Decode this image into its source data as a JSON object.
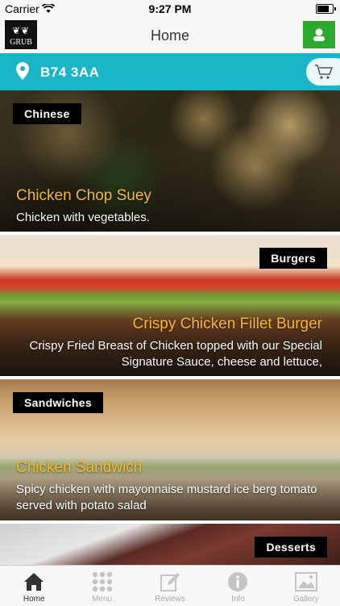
{
  "status_bar": {
    "carrier": "Carrier",
    "time": "9:27 PM"
  },
  "nav": {
    "logo_text": "GRUB",
    "title": "Home"
  },
  "location": {
    "postcode": "B74 3AA"
  },
  "colors": {
    "accent": "#1ab6c8",
    "dish_name": "#f5b830",
    "profile": "#2fa82f"
  },
  "cards": [
    {
      "category": "Chinese",
      "name": "Chicken Chop Suey",
      "description": "Chicken with vegetables."
    },
    {
      "category": "Burgers",
      "name": "Crispy Chicken Fillet Burger",
      "description": "Crispy Fried Breast of Chicken topped with our Special Signature Sauce, cheese and lettuce,"
    },
    {
      "category": "Sandwiches",
      "name": "Chicken Sandwich",
      "description": "Spicy chicken with mayonnaise mustard ice berg tomato served with potato salad"
    },
    {
      "category": "Desserts"
    }
  ],
  "tabs": [
    {
      "label": "Home",
      "icon": "home-icon",
      "active": true
    },
    {
      "label": "Menu",
      "icon": "menu-grid-icon"
    },
    {
      "label": "Reviews",
      "icon": "edit-icon"
    },
    {
      "label": "Info",
      "icon": "info-icon"
    },
    {
      "label": "Gallery",
      "icon": "gallery-icon"
    }
  ]
}
